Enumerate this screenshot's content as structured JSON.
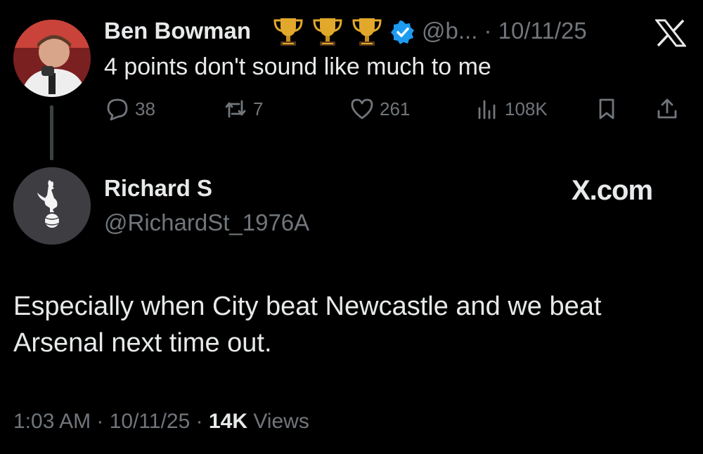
{
  "parent_tweet": {
    "name": "Ben Bowman",
    "handle_time": "@b... · 10/11/25",
    "text": "4 points don't sound like much to me",
    "badges": [
      "trophy-icon",
      "trophy-icon",
      "trophy-icon"
    ],
    "actions": {
      "replies": "38",
      "reposts": "7",
      "likes": "261",
      "views": "108K"
    }
  },
  "reply_tweet": {
    "name": "Richard S",
    "handle": "@RichardSt_1976A",
    "source_mark": "X.com",
    "text_line1": "Especially when City beat Newcastle and we beat",
    "text_line2": "Arsenal next time out.",
    "time": "1:03 AM · 10/11/25 ·",
    "views_count": "14K",
    "views_label": "Views"
  },
  "colors": {
    "background": "#000000",
    "text_primary": "#e7e9ea",
    "text_secondary": "#71767b",
    "verified_blue": "#1d9bf0",
    "trophy_gold": "#e2a82b"
  }
}
